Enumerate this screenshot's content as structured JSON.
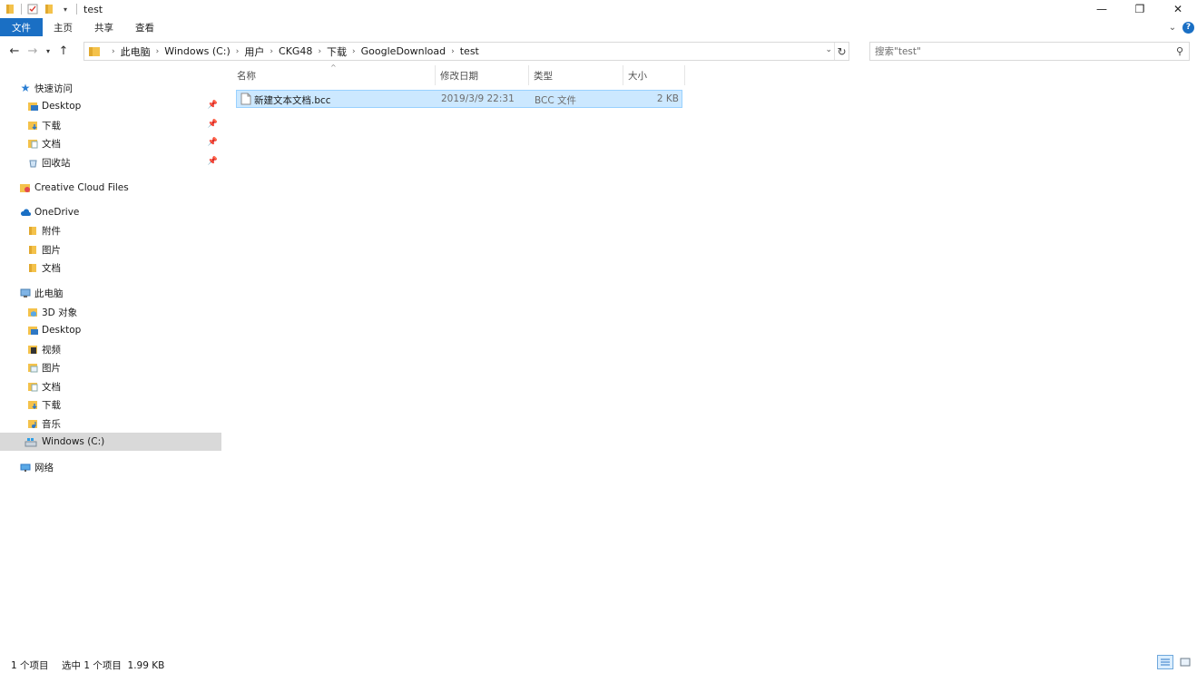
{
  "window": {
    "title": "test"
  },
  "window_controls": {
    "minimize": "—",
    "maximize": "❐",
    "close": "✕"
  },
  "ribbon": {
    "tabs": [
      "文件",
      "主页",
      "共享",
      "查看"
    ]
  },
  "address_bar": {
    "crumbs": [
      "此电脑",
      "Windows (C:)",
      "用户",
      "CKG48",
      "下载",
      "GoogleDownload",
      "test"
    ]
  },
  "search": {
    "placeholder": "搜索\"test\""
  },
  "sidebar": {
    "items": [
      {
        "label": "快速访问",
        "icon": "star-icon",
        "pinned": false
      },
      {
        "label": "Desktop",
        "icon": "desktop-folder-icon",
        "pinned": true
      },
      {
        "label": "下载",
        "icon": "download-folder-icon",
        "pinned": true
      },
      {
        "label": "文档",
        "icon": "documents-folder-icon",
        "pinned": true
      },
      {
        "label": "回收站",
        "icon": "recycle-bin-icon",
        "pinned": true
      },
      {
        "label": "Creative Cloud Files",
        "icon": "creative-cloud-folder-icon",
        "pinned": false
      },
      {
        "label": "OneDrive",
        "icon": "cloud-icon",
        "pinned": false
      },
      {
        "label": "附件",
        "icon": "folder-icon",
        "pinned": false
      },
      {
        "label": "图片",
        "icon": "folder-icon",
        "pinned": false
      },
      {
        "label": "文档",
        "icon": "folder-icon",
        "pinned": false
      },
      {
        "label": "此电脑",
        "icon": "computer-icon",
        "pinned": false
      },
      {
        "label": "3D 对象",
        "icon": "3d-objects-folder-icon",
        "pinned": false
      },
      {
        "label": "Desktop",
        "icon": "desktop-folder-icon",
        "pinned": false
      },
      {
        "label": "视频",
        "icon": "videos-folder-icon",
        "pinned": false
      },
      {
        "label": "图片",
        "icon": "pictures-folder-icon",
        "pinned": false
      },
      {
        "label": "文档",
        "icon": "documents-folder-icon",
        "pinned": false
      },
      {
        "label": "下载",
        "icon": "download-folder-icon",
        "pinned": false
      },
      {
        "label": "音乐",
        "icon": "music-folder-icon",
        "pinned": false
      },
      {
        "label": "Windows (C:)",
        "icon": "drive-icon",
        "pinned": false,
        "selected": true
      },
      {
        "label": "网络",
        "icon": "network-icon",
        "pinned": false
      }
    ]
  },
  "columns": [
    "名称",
    "修改日期",
    "类型",
    "大小"
  ],
  "files": [
    {
      "name": "新建文本文档.bcc",
      "modified": "2019/3/9 22:31",
      "type": "BCC 文件",
      "size": "2 KB",
      "selected": true
    }
  ],
  "status": {
    "item_count": "1 个项目",
    "selection": "选中 1 个项目  1.99 KB"
  },
  "colors": {
    "accent": "#1a6fc4",
    "selection_bg": "#cce8ff",
    "selection_border": "#99d1ff",
    "sidebar_selected": "#d9d9d9"
  }
}
